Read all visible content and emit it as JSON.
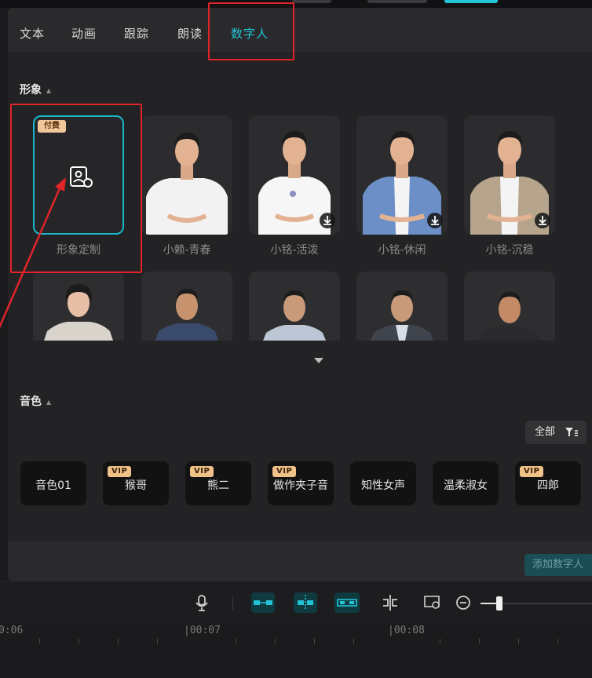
{
  "tabs": [
    {
      "label": "文本"
    },
    {
      "label": "动画"
    },
    {
      "label": "跟踪"
    },
    {
      "label": "朗读"
    },
    {
      "label": "数字人"
    }
  ],
  "active_tab": "数字人",
  "sections": {
    "appearance_title": "形象",
    "voice_title": "音色"
  },
  "custom_card": {
    "badge": "付费",
    "label": "形象定制"
  },
  "avatars": [
    {
      "label": "小赖-青春"
    },
    {
      "label": "小铭-活泼"
    },
    {
      "label": "小铭-休闲"
    },
    {
      "label": "小铭-沉稳"
    }
  ],
  "filter": {
    "label": "全部"
  },
  "voices": [
    {
      "name": "音色01",
      "vip": ""
    },
    {
      "name": "猴哥",
      "vip": "VIP"
    },
    {
      "name": "熊二",
      "vip": "VIP"
    },
    {
      "name": "做作夹子音",
      "vip": "VIP"
    },
    {
      "name": "知性女声",
      "vip": ""
    },
    {
      "name": "温柔淑女",
      "vip": ""
    },
    {
      "name": "四郎",
      "vip": "VIP"
    }
  ],
  "footer": {
    "add_button": "添加数字人"
  },
  "timeline": {
    "ticks": [
      "0:06",
      "|00:07",
      "|00:08"
    ]
  },
  "colors": {
    "accent": "#22c4d6",
    "highlight": "#e0242a",
    "vip_badge": "#f0c28a"
  }
}
